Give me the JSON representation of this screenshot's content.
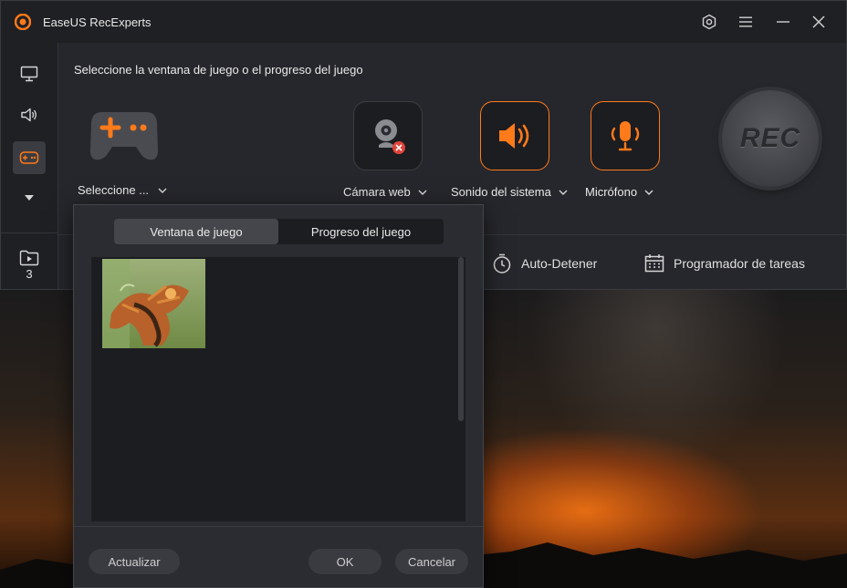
{
  "app": {
    "title": "EaseUS RecExperts",
    "accent_color": "#ff7a1a",
    "titlebar_icons": [
      "settings-hex-icon",
      "menu-icon",
      "minimize-icon",
      "close-icon"
    ]
  },
  "rail": {
    "items": [
      {
        "name": "screen",
        "icon": "monitor-icon"
      },
      {
        "name": "audio",
        "icon": "speaker-icon"
      },
      {
        "name": "game",
        "icon": "gamepad-icon",
        "active": true
      },
      {
        "name": "more",
        "icon": "caret-down-icon"
      }
    ],
    "recordings_count": "3"
  },
  "main": {
    "heading": "Seleccione la ventana de juego o el progreso del juego",
    "game_select_label": "Seleccione ...",
    "sources": [
      {
        "label": "Cámara web",
        "icon": "webcam-icon",
        "status": "disabled"
      },
      {
        "label": "Sonido del sistema",
        "icon": "speaker-icon",
        "status": "enabled"
      },
      {
        "label": "Micrófono",
        "icon": "microphone-icon",
        "status": "enabled"
      }
    ],
    "rec_label": "REC",
    "tools": [
      {
        "label": "Auto-Detener",
        "icon": "timer-icon"
      },
      {
        "label": "Programador de tareas",
        "icon": "calendar-icon"
      }
    ]
  },
  "popup": {
    "tabs": [
      {
        "label": "Ventana de juego",
        "active": true
      },
      {
        "label": "Progreso del juego",
        "active": false
      }
    ],
    "buttons": {
      "refresh": "Actualizar",
      "ok": "OK",
      "cancel": "Cancelar"
    }
  }
}
